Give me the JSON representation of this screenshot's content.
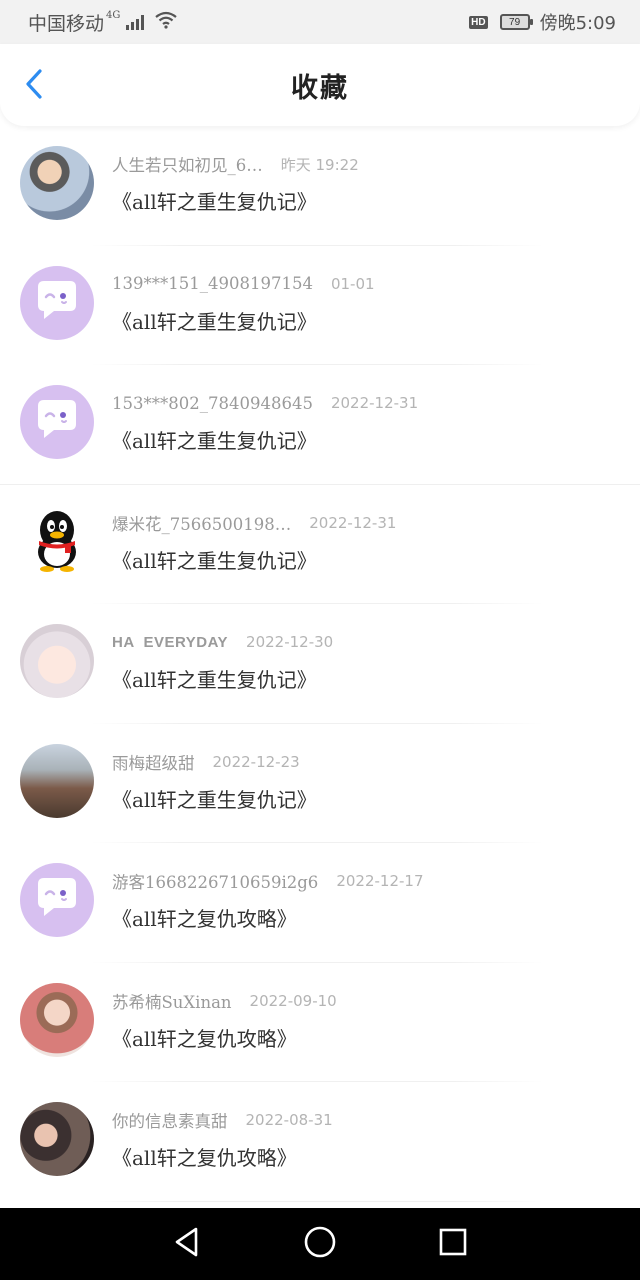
{
  "status_bar": {
    "carrier": "中国移动",
    "network": "4G",
    "hd": "HD",
    "battery": "79",
    "time": "傍晚5:09"
  },
  "header": {
    "title": "收藏",
    "accent_color": "#2d8cf0"
  },
  "items": [
    {
      "username": "人生若只如初见_6…",
      "date": "昨天  19:22",
      "title": "《all轩之重生复仇记》",
      "avatar": "photo-boy"
    },
    {
      "username": "139***151_4908197154",
      "date": "01-01",
      "title": "《all轩之重生复仇记》",
      "avatar": "chat-bubble"
    },
    {
      "username": "153***802_7840948645",
      "date": "2022-12-31",
      "title": "《all轩之重生复仇记》",
      "avatar": "chat-bubble"
    },
    {
      "username": "爆米花_7566500198…",
      "date": "2022-12-31",
      "title": "《all轩之重生复仇记》",
      "avatar": "penguin"
    },
    {
      "username": "HA  EVERYDAY",
      "date": "2022-12-30",
      "title": "《all轩之重生复仇记》",
      "avatar": "anime-girl"
    },
    {
      "username": "雨梅超级甜",
      "date": "2022-12-23",
      "title": "《all轩之重生复仇记》",
      "avatar": "castle-photo"
    },
    {
      "username": "游客1668226710659i2g6",
      "date": "2022-12-17",
      "title": "《all轩之复仇攻略》",
      "avatar": "chat-bubble"
    },
    {
      "username": "苏希楠SuXinan",
      "date": "2022-09-10",
      "title": "《all轩之复仇攻略》",
      "avatar": "girl-photo"
    },
    {
      "username": "你的信息素真甜",
      "date": "2022-08-31",
      "title": "《all轩之复仇攻略》",
      "avatar": "couple-photo"
    }
  ],
  "nav": {
    "back": "back-triangle-icon",
    "home": "home-circle-icon",
    "recents": "recents-square-icon"
  }
}
